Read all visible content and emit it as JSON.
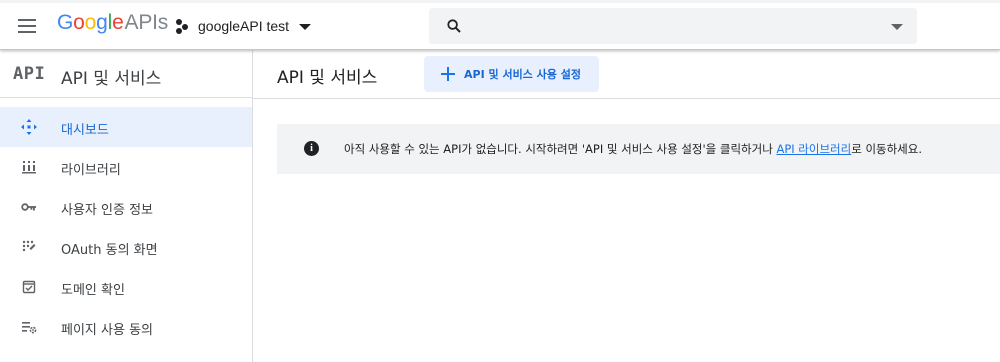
{
  "header": {
    "logo_google": "Google",
    "logo_apis": "APIs",
    "project_name": "googleAPI test",
    "search_placeholder": ""
  },
  "sidebar": {
    "badge": "API",
    "title": "API 및 서비스",
    "items": [
      {
        "label": "대시보드",
        "icon": "dashboard-icon",
        "active": true
      },
      {
        "label": "라이브러리",
        "icon": "library-icon",
        "active": false
      },
      {
        "label": "사용자 인증 정보",
        "icon": "key-icon",
        "active": false
      },
      {
        "label": "OAuth 동의 화면",
        "icon": "oauth-consent-icon",
        "active": false
      },
      {
        "label": "도메인 확인",
        "icon": "domain-verification-icon",
        "active": false
      },
      {
        "label": "페이지 사용 동의",
        "icon": "page-usage-settings-icon",
        "active": false
      }
    ]
  },
  "main": {
    "title": "API 및 서비스",
    "enable_button": "API 및 서비스 사용 설정",
    "notice_before": "아직 사용할 수 있는 API가 없습니다. 시작하려면 'API 및 서비스 사용 설정'을 클릭하거나 ",
    "notice_link": "API 라이브러리",
    "notice_after": "로 이동하세요."
  },
  "colors": {
    "google_blue": "#4285f4",
    "google_red": "#ea4335",
    "google_yellow": "#fbbc05",
    "google_green": "#34a853",
    "active_nav_bg": "#e8f0fe",
    "accent": "#1a73e8"
  }
}
